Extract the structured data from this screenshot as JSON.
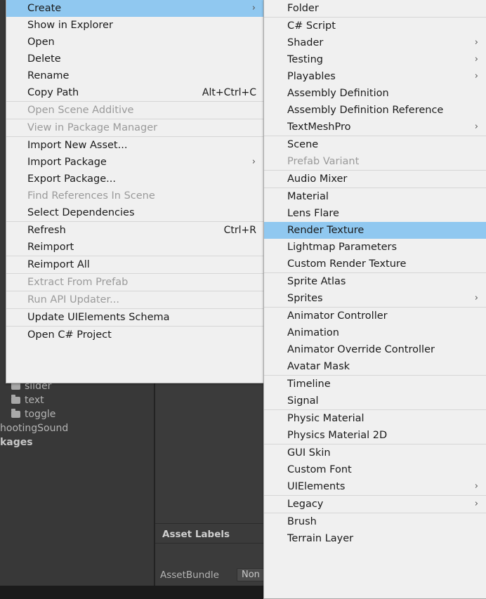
{
  "colors": {
    "menu_bg": "#f0f0f0",
    "menu_border": "#a9a9a9",
    "highlight": "#90c8f0",
    "separator": "#d6d6d6",
    "text": "#1a1a1a",
    "text_disabled": "#9a9a9a",
    "editor_bg": "#383838",
    "panel_bg": "#3b3b3b"
  },
  "project_tree": {
    "items": [
      {
        "label": "slider",
        "icon": "folder-icon",
        "indent": 16,
        "bold": false,
        "clipped_top": true
      },
      {
        "label": "text",
        "icon": "folder-icon",
        "indent": 16,
        "bold": false
      },
      {
        "label": "toggle",
        "icon": "folder-icon",
        "indent": 16,
        "bold": false
      },
      {
        "label": "hootingSound",
        "icon": "none",
        "indent": 0,
        "bold": false
      },
      {
        "label": "kages",
        "icon": "none",
        "indent": 0,
        "bold": true
      }
    ]
  },
  "inspector": {
    "asset_labels_header": "Asset Labels",
    "assetbundle_label": "AssetBundle",
    "assetbundle_value": "Non"
  },
  "context_menu": {
    "name": "asset-context-menu",
    "items": [
      {
        "label": "Create",
        "selected": true,
        "submenu": true,
        "arrow": "›"
      },
      {
        "label": "Show in Explorer"
      },
      {
        "label": "Open"
      },
      {
        "label": "Delete"
      },
      {
        "label": "Rename"
      },
      {
        "label": "Copy Path",
        "shortcut": "Alt+Ctrl+C"
      },
      {
        "separator": true
      },
      {
        "label": "Open Scene Additive",
        "disabled": true
      },
      {
        "separator": true
      },
      {
        "label": "View in Package Manager",
        "disabled": true
      },
      {
        "separator": true
      },
      {
        "label": "Import New Asset..."
      },
      {
        "label": "Import Package",
        "submenu": true,
        "arrow": "›"
      },
      {
        "label": "Export Package..."
      },
      {
        "label": "Find References In Scene",
        "disabled": true
      },
      {
        "label": "Select Dependencies"
      },
      {
        "separator": true
      },
      {
        "label": "Refresh",
        "shortcut": "Ctrl+R"
      },
      {
        "label": "Reimport"
      },
      {
        "separator": true
      },
      {
        "label": "Reimport All"
      },
      {
        "separator": true
      },
      {
        "label": "Extract From Prefab",
        "disabled": true
      },
      {
        "separator": true
      },
      {
        "label": "Run API Updater...",
        "disabled": true
      },
      {
        "separator": true
      },
      {
        "label": "Update UIElements Schema"
      },
      {
        "separator": true
      },
      {
        "label": "Open C# Project"
      }
    ]
  },
  "create_submenu": {
    "name": "create-submenu",
    "items": [
      {
        "label": "Folder"
      },
      {
        "separator": true
      },
      {
        "label": "C# Script"
      },
      {
        "label": "Shader",
        "submenu": true,
        "arrow": "›"
      },
      {
        "label": "Testing",
        "submenu": true,
        "arrow": "›"
      },
      {
        "label": "Playables",
        "submenu": true,
        "arrow": "›"
      },
      {
        "label": "Assembly Definition"
      },
      {
        "label": "Assembly Definition Reference"
      },
      {
        "label": "TextMeshPro",
        "submenu": true,
        "arrow": "›"
      },
      {
        "separator": true
      },
      {
        "label": "Scene"
      },
      {
        "label": "Prefab Variant",
        "disabled": true
      },
      {
        "separator": true
      },
      {
        "label": "Audio Mixer"
      },
      {
        "separator": true
      },
      {
        "label": "Material"
      },
      {
        "label": "Lens Flare"
      },
      {
        "label": "Render Texture",
        "selected": true
      },
      {
        "label": "Lightmap Parameters"
      },
      {
        "label": "Custom Render Texture"
      },
      {
        "separator": true
      },
      {
        "label": "Sprite Atlas"
      },
      {
        "label": "Sprites",
        "submenu": true,
        "arrow": "›"
      },
      {
        "separator": true
      },
      {
        "label": "Animator Controller"
      },
      {
        "label": "Animation"
      },
      {
        "label": "Animator Override Controller"
      },
      {
        "label": "Avatar Mask"
      },
      {
        "separator": true
      },
      {
        "label": "Timeline"
      },
      {
        "label": "Signal"
      },
      {
        "separator": true
      },
      {
        "label": "Physic Material"
      },
      {
        "label": "Physics Material 2D"
      },
      {
        "separator": true
      },
      {
        "label": "GUI Skin"
      },
      {
        "label": "Custom Font"
      },
      {
        "label": "UIElements",
        "submenu": true,
        "arrow": "›"
      },
      {
        "separator": true
      },
      {
        "label": "Legacy",
        "submenu": true,
        "arrow": "›"
      },
      {
        "separator": true
      },
      {
        "label": "Brush"
      },
      {
        "label": "Terrain Layer"
      }
    ]
  }
}
